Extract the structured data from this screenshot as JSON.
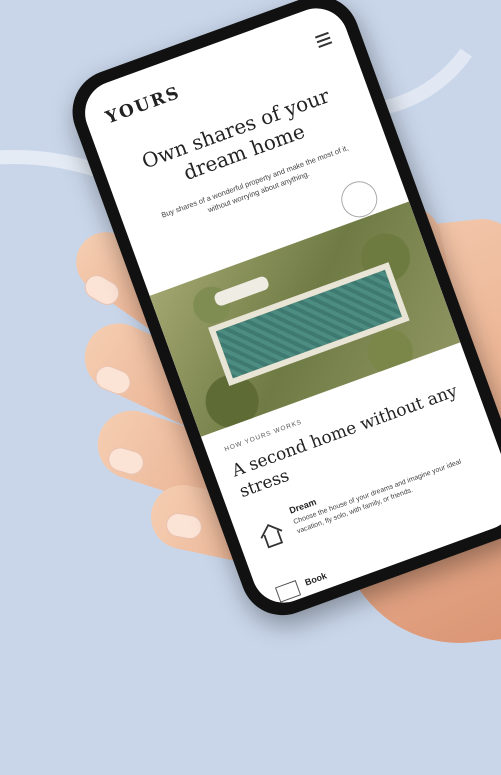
{
  "phone_screen": {
    "logo": "YOURS",
    "hero_title": "Own shares of your dream home",
    "hero_text": "Buy shares of a wonderful property and make the most of it, without worrying about anything.",
    "section_kicker": "HOW YOURS WORKS",
    "section_title": "A second home without any stress",
    "feature_title": "Dream",
    "feature_text": "Choose the house of your dreams and imagine your ideal vacation, fly solo, with family, or friends.",
    "bottom_label": "Book"
  },
  "icons": [
    "menu-icon",
    "home-icon",
    "calendar-icon",
    "stamp-icon"
  ],
  "colors": {
    "background": "#c9d6ea",
    "phone_frame": "#111111",
    "screen": "#ffffff"
  }
}
